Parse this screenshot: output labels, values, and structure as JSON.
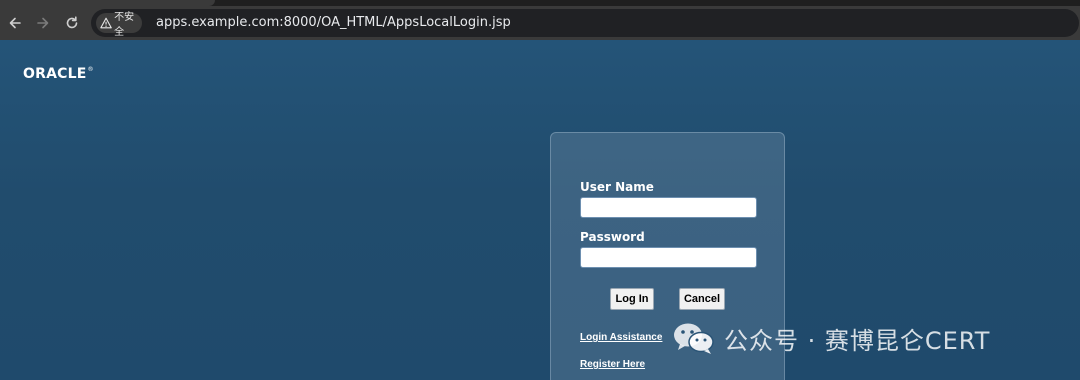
{
  "browser": {
    "security_chip_text": "不安全",
    "url": "apps.example.com:8000/OA_HTML/AppsLocalLogin.jsp"
  },
  "page": {
    "logo_text": "ORACLE",
    "logo_mark": "®"
  },
  "login": {
    "username_label": "User Name",
    "username_value": "",
    "password_label": "Password",
    "password_value": "",
    "login_button": "Log In",
    "cancel_button": "Cancel",
    "login_assistance_link": "Login Assistance",
    "register_link": "Register Here"
  },
  "watermark": {
    "text": "公众号 · 赛博昆仑CERT",
    "icon": "wechat-icon"
  }
}
